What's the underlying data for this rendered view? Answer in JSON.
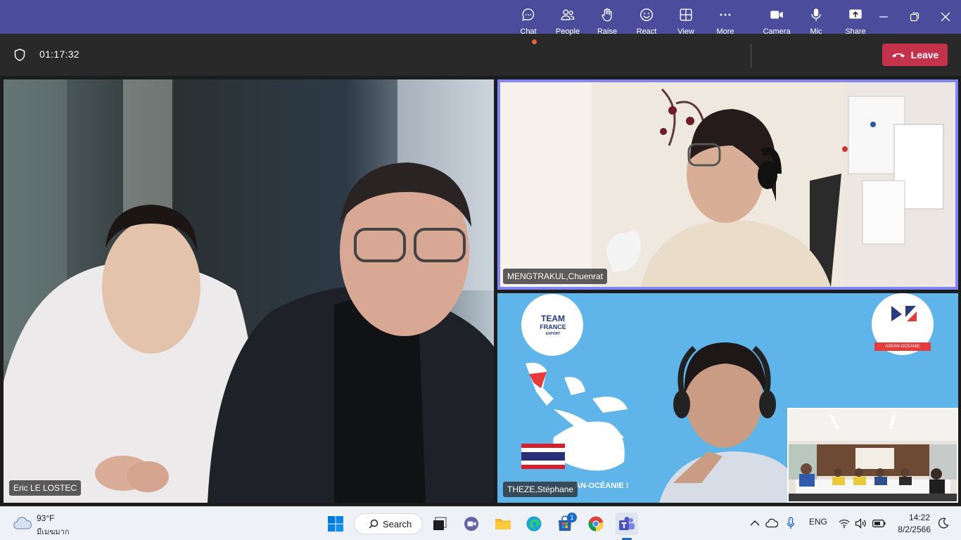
{
  "window": {
    "controls": [
      "minimize-icon",
      "restore-icon",
      "close-icon"
    ],
    "accent": "#4b4c9c"
  },
  "meeting": {
    "timer": "01:17:32",
    "toolbar": {
      "chat": "Chat",
      "people": "People",
      "raise": "Raise",
      "react": "React",
      "view": "View",
      "more": "More",
      "camera": "Camera",
      "mic": "Mic",
      "share": "Share",
      "leave": "Leave"
    },
    "leave_color": "#c4314b",
    "participants": [
      {
        "name": "Eric LE LOSTEC"
      },
      {
        "name": "MENGTRAKUL,Chuenrat",
        "active_speaker": true
      },
      {
        "name": "THEZE,Stéphane"
      }
    ],
    "slide": {
      "logo_left": [
        "TEAM",
        "FRANCE",
        "EXPORT"
      ],
      "logo_right": "ASEAN-OCEANIE",
      "tagline": "AN-OCÉANIE !"
    }
  },
  "taskbar": {
    "weather": {
      "temp": "93°F",
      "desc": "มีเมฆมาก"
    },
    "search_label": "Search",
    "store_badge": "1",
    "tray": {
      "language": "ENG"
    },
    "clock": {
      "time": "14:22",
      "date": "8/2/2566"
    }
  }
}
